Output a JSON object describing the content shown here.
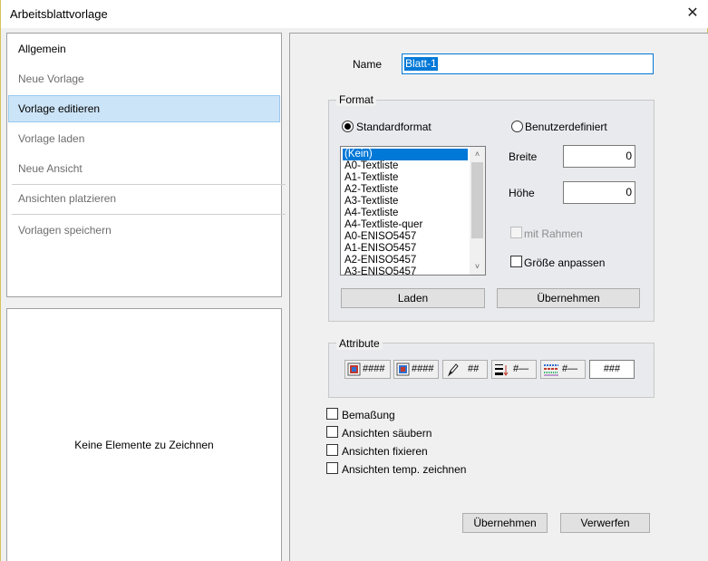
{
  "window": {
    "title": "Arbeitsblattvorlage",
    "close_glyph": "✕"
  },
  "nav": {
    "items": [
      {
        "label": "Allgemein"
      },
      {
        "label": "Neue Vorlage"
      },
      {
        "label": "Vorlage editieren"
      },
      {
        "label": "Vorlage laden"
      },
      {
        "label": "Neue Ansicht"
      },
      {
        "label": "Ansichten platzieren"
      },
      {
        "label": "Vorlagen speichern"
      }
    ]
  },
  "preview": {
    "empty_text": "Keine Elemente zu Zeichnen"
  },
  "name_field": {
    "label": "Name",
    "value": "Blatt-1"
  },
  "format": {
    "title": "Format",
    "standard_label": "Standardformat",
    "custom_label": "Benutzerdefiniert",
    "selected": "Standardformat",
    "list": [
      "(Kein)",
      "A0-Textliste",
      "A1-Textliste",
      "A2-Textliste",
      "A3-Textliste",
      "A4-Textliste",
      "A4-Textliste-quer",
      "A0-ENISO5457",
      "A1-ENISO5457",
      "A2-ENISO5457",
      "A3-ENISO5457"
    ],
    "list_selected": "(Kein)",
    "width_label": "Breite",
    "width_value": "0",
    "height_label": "Höhe",
    "height_value": "0",
    "frame_label": "mit Rahmen",
    "fit_label": "Größe anpassen",
    "load_button": "Laden",
    "apply_button": "Übernehmen"
  },
  "attribute": {
    "title": "Attribute",
    "buttons": [
      {
        "icon": "color-attr-icon",
        "text": "####"
      },
      {
        "icon": "color-attr-alt-icon",
        "text": "####"
      },
      {
        "icon": "pen-icon",
        "text": "##"
      },
      {
        "icon": "line-weight-icon",
        "text": "#—"
      },
      {
        "icon": "line-style-icon",
        "text": "#—"
      },
      {
        "icon": "",
        "text": "###"
      }
    ]
  },
  "options": [
    {
      "label": "Bemaßung",
      "checked": false
    },
    {
      "label": "Ansichten säubern",
      "checked": false
    },
    {
      "label": "Ansichten fixieren",
      "checked": false
    },
    {
      "label": "Ansichten temp. zeichnen",
      "checked": false
    }
  ],
  "footer": {
    "ok_button": "Übernehmen",
    "cancel_button": "Verwerfen"
  },
  "colors": {
    "selection": "#0078d7",
    "nav_selected_bg": "#cce4f7",
    "dialog_bg": "#f0f0f0"
  }
}
